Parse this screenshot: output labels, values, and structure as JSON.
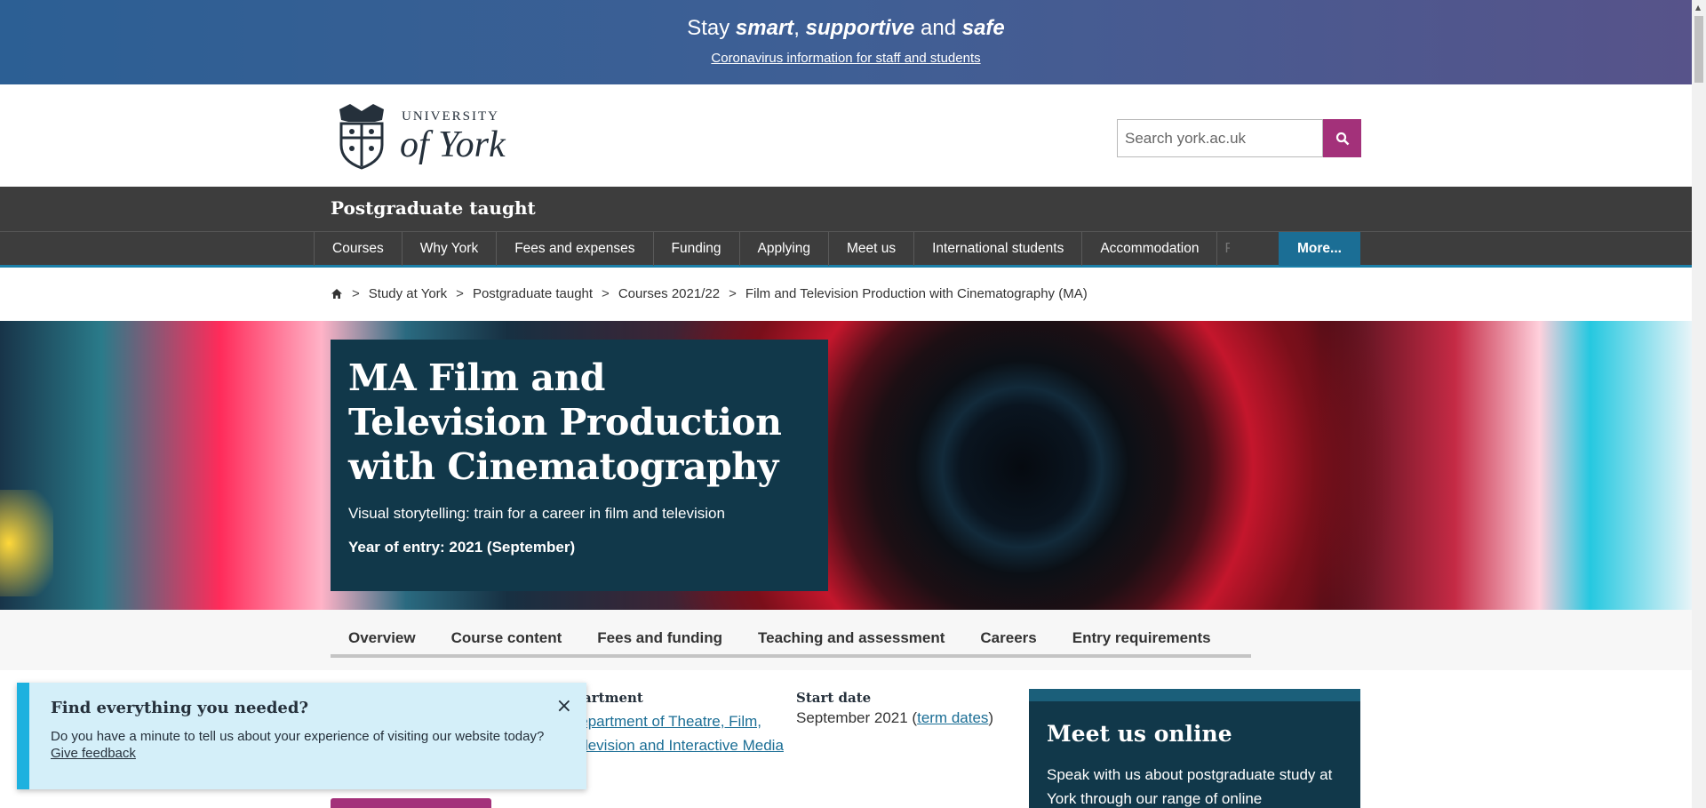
{
  "banner": {
    "title_prefix": "Stay ",
    "title_b1": "smart",
    "title_mid1": ", ",
    "title_b2": "supportive",
    "title_mid2": " and ",
    "title_b3": "safe",
    "link": "Coronavirus information for staff and students"
  },
  "header": {
    "logo_top": "UNIVERSITY",
    "logo_main": "of York",
    "search_placeholder": "Search york.ac.uk"
  },
  "section_title": "Postgraduate taught",
  "nav": {
    "items": [
      "Courses",
      "Why York",
      "Fees and expenses",
      "Funding",
      "Applying",
      "Meet us",
      "International students",
      "Accommodation"
    ],
    "clipped": "P",
    "more": "More..."
  },
  "breadcrumb": {
    "sep": ">",
    "items": [
      "Study at York",
      "Postgraduate taught",
      "Courses 2021/22",
      "Film and Television Production with Cinematography (MA)"
    ]
  },
  "hero": {
    "title": "MA Film and Television Production with Cinematography",
    "subtitle": "Visual storytelling: train for a career in film and television",
    "year": "Year of entry: 2021 (September)"
  },
  "tabs": [
    "Overview",
    "Course content",
    "Fees and funding",
    "Teaching and assessment",
    "Careers",
    "Entry requirements"
  ],
  "facts": {
    "dept_label": "Department",
    "dept_value": "Department of Theatre, Film, Television and Interactive Media",
    "start_label": "Start date",
    "start_value": "September 2021 (",
    "start_link": "term dates",
    "start_close": ")"
  },
  "meet": {
    "title": "Meet us online",
    "text": "Speak with us about postgraduate study at York through our range of online"
  },
  "feedback": {
    "title": "Find everything you needed?",
    "text": "Do you have a minute to tell us about your experience of visiting our website today? ",
    "link": "Give feedback",
    "close": "×"
  }
}
